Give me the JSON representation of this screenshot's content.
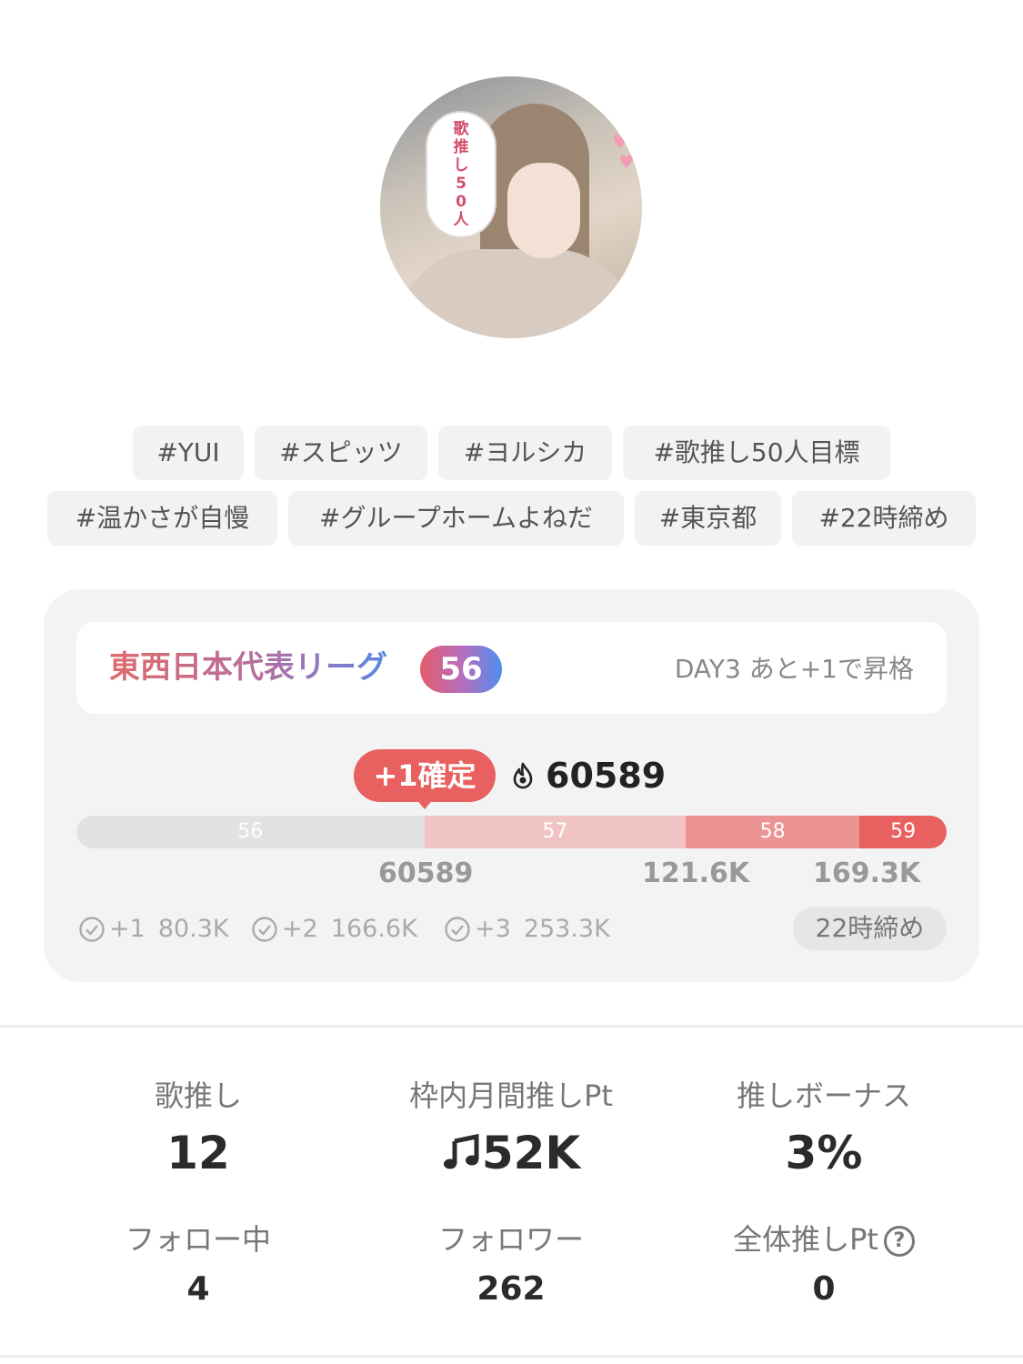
{
  "profile": {
    "avatar_bubble_lines": [
      "歌",
      "推",
      "し",
      "5",
      "0",
      "人"
    ]
  },
  "tags": [
    "#YUI",
    "#スピッツ",
    "#ヨルシカ",
    "#歌推し50人目標",
    "#温かさが自慢",
    "#グループホームよねだ",
    "#東京都",
    "#22時締め"
  ],
  "league": {
    "title": "東西日本代表リーグ",
    "rank": "56",
    "status": "DAY3 あと+1で昇格",
    "confirm_label": "+1確定",
    "score": "60589",
    "progress_segments": [
      {
        "label": "56",
        "color": "#e2e2e2",
        "share": 0.4
      },
      {
        "label": "57",
        "color": "#f1c4c4",
        "share": 0.3
      },
      {
        "label": "58",
        "color": "#ec9393",
        "share": 0.2
      },
      {
        "label": "59",
        "color": "#e8605f",
        "share": 0.1
      }
    ],
    "thresholds": [
      "60589",
      "121.6K",
      "169.3K"
    ],
    "bonus_targets": [
      {
        "label": "+1",
        "value": "80.3K"
      },
      {
        "label": "+2",
        "value": "166.6K"
      },
      {
        "label": "+3",
        "value": "253.3K"
      }
    ],
    "deadline": "22時締め"
  },
  "stats": {
    "song_push": {
      "label": "歌推し",
      "value": "12"
    },
    "monthly_pt": {
      "label": "枠内月間推しPt",
      "value": "52K",
      "icon": "music-note-icon"
    },
    "bonus": {
      "label": "推しボーナス",
      "value": "3%"
    },
    "following": {
      "label": "フォロー中",
      "value": "4"
    },
    "followers": {
      "label": "フォロワー",
      "value": "262"
    },
    "total_pt": {
      "label": "全体推しPt",
      "value": "0",
      "help_icon": "?"
    }
  },
  "colors": {
    "accent": "#e8605f",
    "card_bg": "#f3f3f3",
    "tag_bg": "#f2f2f2"
  }
}
